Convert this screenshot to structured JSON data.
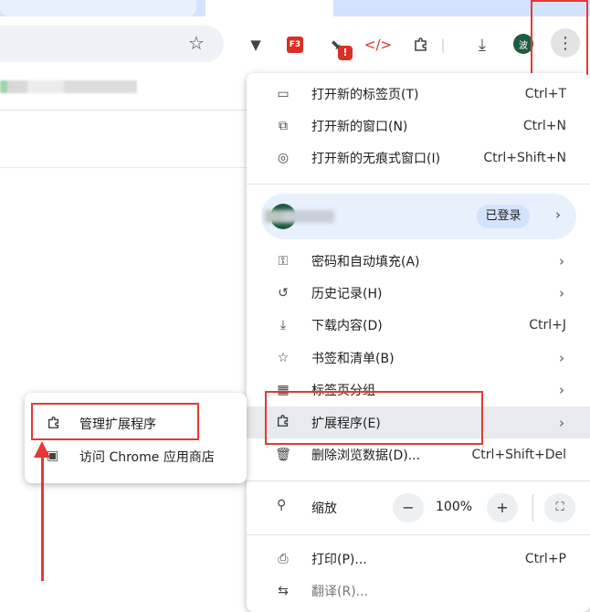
{
  "toolbar": {
    "f3_label": "F3",
    "badge": "!",
    "profile_initial": "波"
  },
  "menu": {
    "new_tab": {
      "label": "打开新的标签页(T)",
      "shortcut": "Ctrl+T"
    },
    "new_window": {
      "label": "打开新的窗口(N)",
      "shortcut": "Ctrl+N"
    },
    "incognito": {
      "label": "打开新的无痕式窗口(I)",
      "shortcut": "Ctrl+Shift+N"
    },
    "profile": {
      "status": "已登录"
    },
    "passwords": {
      "label": "密码和自动填充(A)"
    },
    "history": {
      "label": "历史记录(H)"
    },
    "downloads": {
      "label": "下载内容(D)",
      "shortcut": "Ctrl+J"
    },
    "bookmarks": {
      "label": "书签和清单(B)"
    },
    "tab_groups": {
      "label": "标签页分组"
    },
    "extensions": {
      "label": "扩展程序(E)"
    },
    "clear_data": {
      "label": "删除浏览数据(D)...",
      "shortcut": "Ctrl+Shift+Del"
    },
    "zoom": {
      "label": "缩放",
      "minus": "−",
      "value": "100%",
      "plus": "+"
    },
    "print": {
      "label": "打印(P)...",
      "shortcut": "Ctrl+P"
    },
    "translate": {
      "label": "翻译(R)..."
    }
  },
  "submenu": {
    "manage": {
      "label": "管理扩展程序"
    },
    "store": {
      "label": "访问 Chrome 应用商店"
    }
  },
  "colors": {
    "highlight": "#e53935",
    "accent_bg": "#e8f0fe"
  }
}
